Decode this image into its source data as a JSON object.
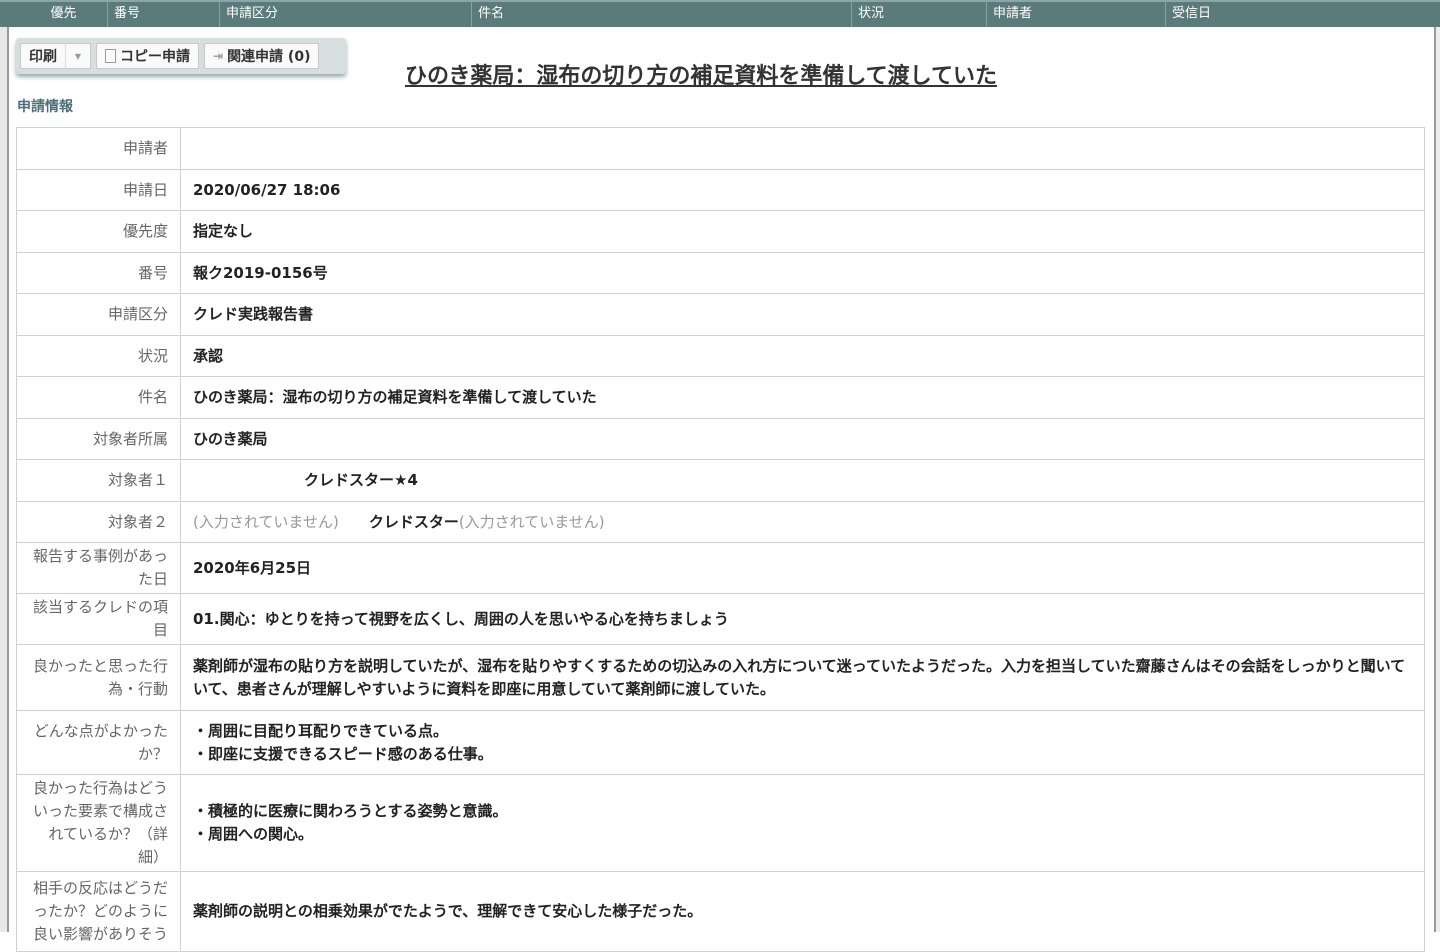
{
  "header_columns": [
    "優先",
    "番号",
    "申請区分",
    "件名",
    "状況",
    "申請者",
    "受信日"
  ],
  "toolbar": {
    "print": "印刷",
    "copy": "コピー申請",
    "related": "関連申請 (0)"
  },
  "title": "ひのき薬局：湿布の切り方の補足資料を準備して渡していた",
  "section": "申請情報",
  "rows": [
    {
      "label": "申請者",
      "value": ""
    },
    {
      "label": "申請日",
      "value": "2020/06/27 18:06"
    },
    {
      "label": "優先度",
      "value": "指定なし"
    },
    {
      "label": "番号",
      "value": "報ク2019-0156号"
    },
    {
      "label": "申請区分",
      "value": "クレド実践報告書"
    },
    {
      "label": "状況",
      "value": "承認"
    },
    {
      "label": "件名",
      "value": "ひのき薬局：湿布の切り方の補足資料を準備して渡していた"
    },
    {
      "label": "対象者所属",
      "value": "ひのき薬局"
    },
    {
      "label": "対象者１",
      "value": "クレドスター★4"
    },
    {
      "label": "対象者２",
      "empty1": "(入力されていません)",
      "value": "クレドスター",
      "empty2": "(入力されていません)"
    },
    {
      "label": "報告する事例があった日",
      "value": "2020年6月25日"
    },
    {
      "label": "該当するクレドの項目",
      "value": "01.関心：ゆとりを持って視野を広くし、周囲の人を思いやる心を持ちましょう"
    },
    {
      "label": "良かったと思った行為・行動",
      "value": "薬剤師が湿布の貼り方を説明していたが、湿布を貼りやすくするための切込みの入れ方について迷っていたようだった。入力を担当していた齋藤さんはその会話をしっかりと聞いていて、患者さんが理解しやすいように資料を即座に用意していて薬剤師に渡していた。"
    },
    {
      "label": "どんな点がよかったか？",
      "lines": [
        "・周囲に目配り耳配りできている点。",
        "・即座に支援できるスピード感のある仕事。"
      ]
    },
    {
      "label": "良かった行為はどういった要素で構成されているか？（詳細）",
      "lines": [
        "・積極的に医療に関わろうとする姿勢と意識。",
        "・周囲への関心。"
      ]
    },
    {
      "label": "相手の反応はどうだったか？どのように良い影響がありそう",
      "value": "薬剤師の説明との相乗効果がでたようで、理解できて安心した様子だった。"
    }
  ]
}
